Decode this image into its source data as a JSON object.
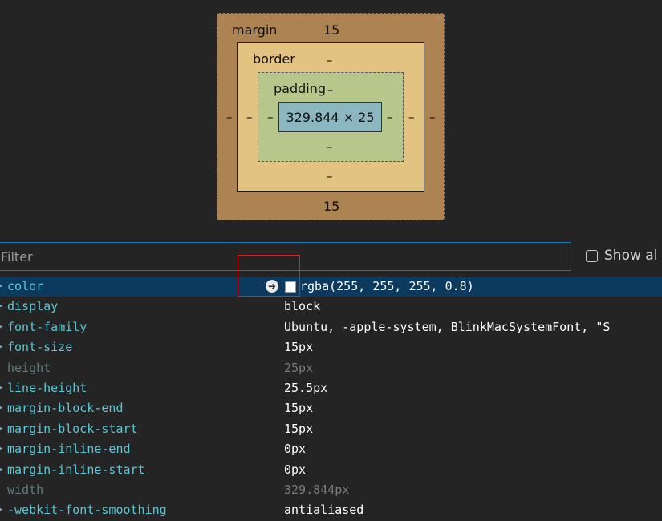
{
  "box_model": {
    "margin_label": "margin",
    "margin_top": "15",
    "margin_bottom": "15",
    "margin_left": "–",
    "margin_right": "–",
    "border_label": "border",
    "border_top": "–",
    "border_bottom": "–",
    "border_left": "–",
    "border_right": "–",
    "padding_label": "padding",
    "padding_top": "–",
    "padding_bottom": "–",
    "padding_left": "–",
    "padding_right": "–",
    "content_size": "329.844 × 25"
  },
  "filter": {
    "placeholder": "Filter",
    "show_all_label": "Show al"
  },
  "properties": [
    {
      "name": "color",
      "value": "rgba(255, 255, 255, 0.8)",
      "inherited": false,
      "expandable": true,
      "selected": true
    },
    {
      "name": "display",
      "value": "block",
      "inherited": false,
      "expandable": true
    },
    {
      "name": "font-family",
      "value": "Ubuntu, -apple-system, BlinkMacSystemFont, \"S",
      "inherited": false,
      "expandable": true
    },
    {
      "name": "font-size",
      "value": "15px",
      "inherited": false,
      "expandable": true
    },
    {
      "name": "height",
      "value": "25px",
      "inherited": true,
      "expandable": false
    },
    {
      "name": "line-height",
      "value": "25.5px",
      "inherited": false,
      "expandable": true
    },
    {
      "name": "margin-block-end",
      "value": "15px",
      "inherited": false,
      "expandable": true
    },
    {
      "name": "margin-block-start",
      "value": "15px",
      "inherited": false,
      "expandable": true
    },
    {
      "name": "margin-inline-end",
      "value": "0px",
      "inherited": false,
      "expandable": true
    },
    {
      "name": "margin-inline-start",
      "value": "0px",
      "inherited": false,
      "expandable": true
    },
    {
      "name": "width",
      "value": "329.844px",
      "inherited": true,
      "expandable": false
    },
    {
      "name": "-webkit-font-smoothing",
      "value": "antialiased",
      "inherited": false,
      "expandable": true
    }
  ],
  "colors": {
    "margin": "#ae8352",
    "border": "#e3c381",
    "padding": "#b7c68a",
    "content": "#8cb6c0",
    "accent": "#0e79b6",
    "selected_row": "#0c3a5e",
    "property_name": "#5ac8d8",
    "highlight": "#e02020"
  }
}
